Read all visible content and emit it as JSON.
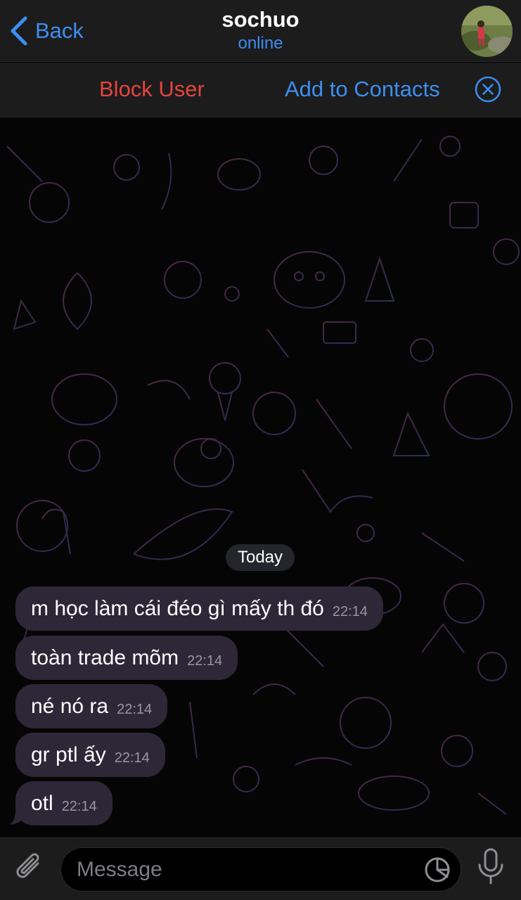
{
  "header": {
    "back_label": "Back",
    "title": "sochuo",
    "status": "online"
  },
  "actions": {
    "block_label": "Block User",
    "add_label": "Add to Contacts"
  },
  "chat": {
    "date_label": "Today",
    "messages": [
      {
        "text": "m học làm cái đéo gì mấy th đó",
        "time": "22:14"
      },
      {
        "text": "toàn trade mõm",
        "time": "22:14"
      },
      {
        "text": "né nó ra",
        "time": "22:14"
      },
      {
        "text": "gr ptl ấy",
        "time": "22:14"
      },
      {
        "text": "otl",
        "time": "22:14"
      }
    ]
  },
  "input": {
    "placeholder": "Message"
  },
  "colors": {
    "accent": "#3d8ef0",
    "danger": "#e5443d",
    "bubble": "#2e2738"
  },
  "icons": [
    "chevron-left-icon",
    "avatar",
    "close-circle-icon",
    "paperclip-icon",
    "sticker-icon",
    "microphone-icon"
  ]
}
